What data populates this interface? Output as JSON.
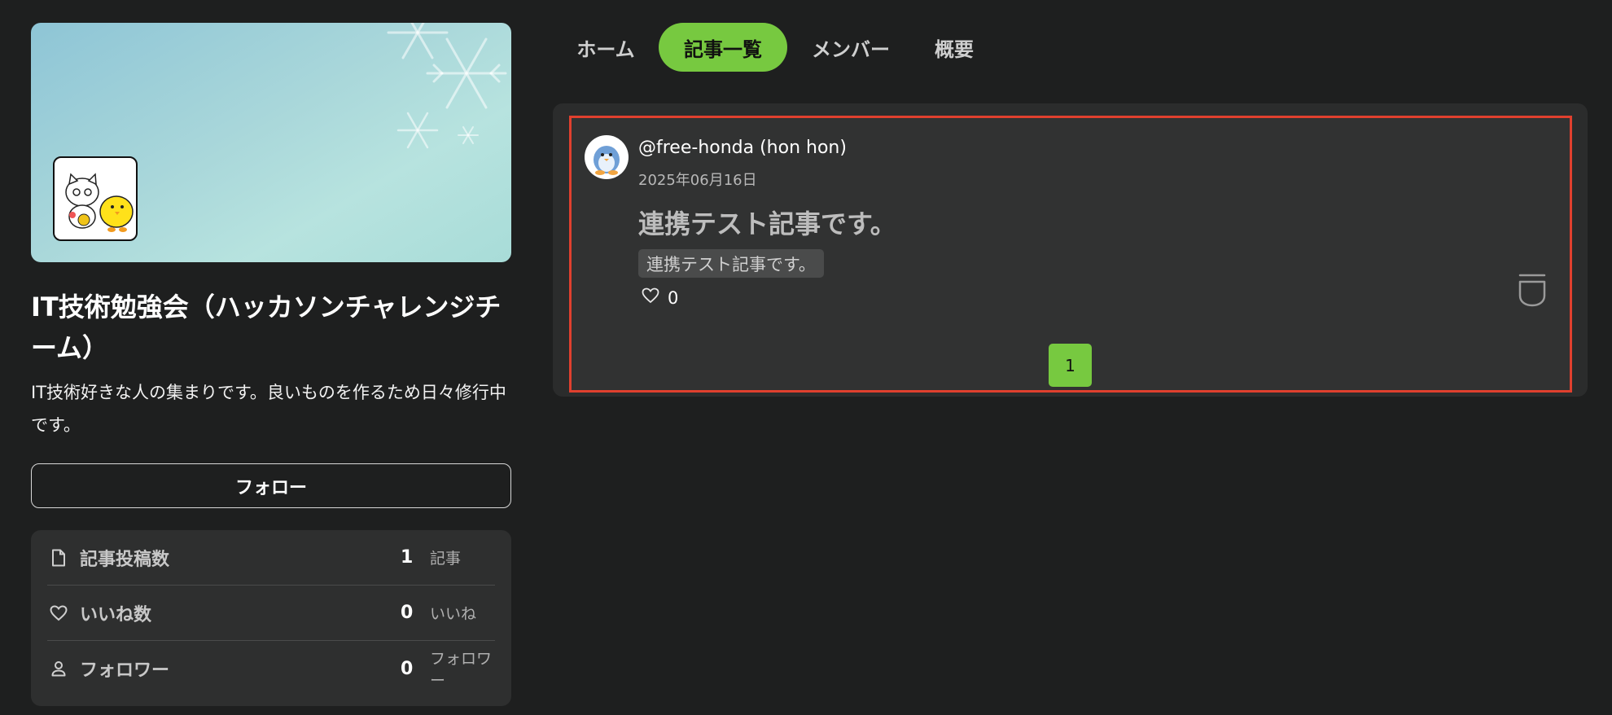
{
  "group": {
    "title": "IT技術勉強会（ハッカソンチャレンジチーム）",
    "description": "IT技術好きな人の集まりです。良いものを作るため日々修行中です。",
    "follow_label": "フォロー"
  },
  "stats": [
    {
      "icon": "document-icon",
      "label": "記事投稿数",
      "value": "1",
      "unit": "記事"
    },
    {
      "icon": "heart-icon",
      "label": "いいね数",
      "value": "0",
      "unit": "いいね"
    },
    {
      "icon": "person-icon",
      "label": "フォロワー",
      "value": "0",
      "unit": "フォロワー"
    }
  ],
  "tabs": [
    {
      "label": "ホーム",
      "active": false
    },
    {
      "label": "記事一覧",
      "active": true
    },
    {
      "label": "メンバー",
      "active": false
    },
    {
      "label": "概要",
      "active": false
    }
  ],
  "article": {
    "author": "@free-honda (hon hon)",
    "date": "2025年06月16日",
    "title": "連携テスト記事です。",
    "tag": "連携テスト記事です。",
    "likes": "0"
  },
  "pagination": {
    "current": "1"
  },
  "colors": {
    "background": "#1e1f1f",
    "accent": "#77c940",
    "highlight_border": "#e0402e",
    "card": "#2e2f2f"
  }
}
